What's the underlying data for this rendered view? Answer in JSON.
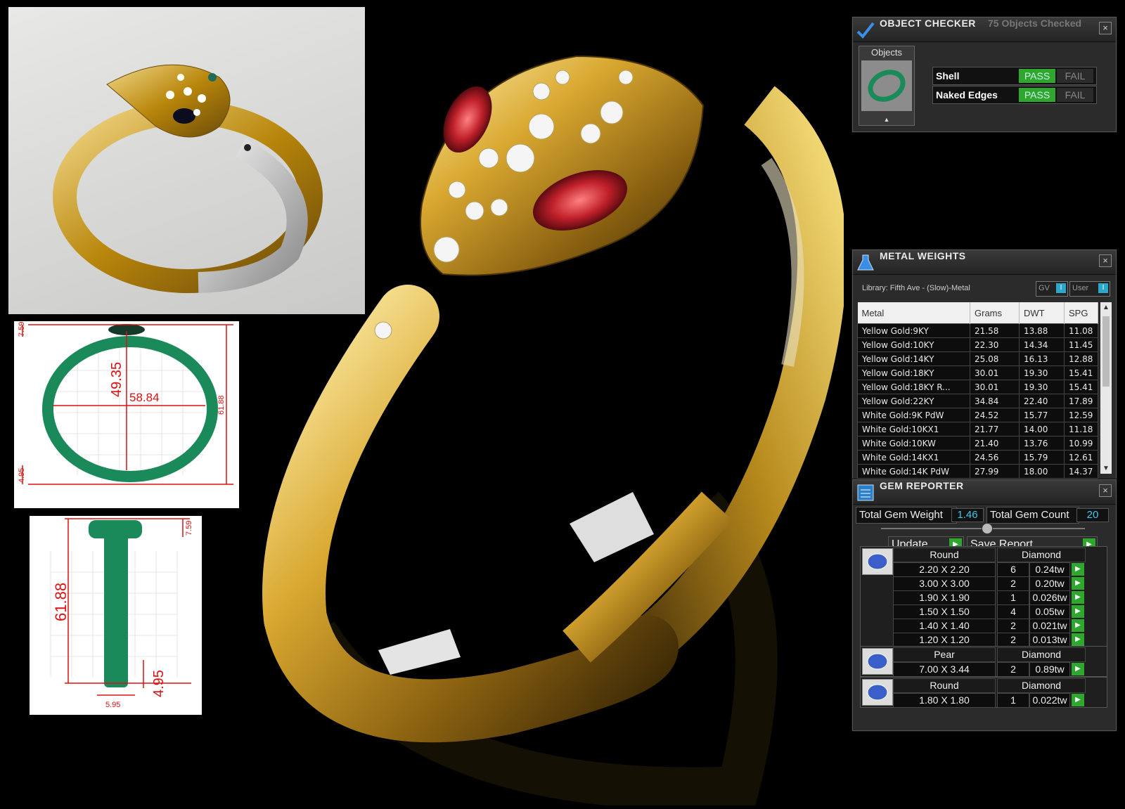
{
  "object_checker": {
    "title": "OBJECT CHECKER",
    "count_text": "75 Objects Checked",
    "objects_label": "Objects",
    "checks": [
      {
        "label": "Shell",
        "pass": "PASS",
        "fail": "FAIL"
      },
      {
        "label": "Naked Edges",
        "pass": "PASS",
        "fail": "FAIL"
      }
    ]
  },
  "metal_weights": {
    "title": "METAL WEIGHTS",
    "library": "Library: Fifth Ave - (Slow)-Metal",
    "toggle_gv": "GV",
    "toggle_user": "User",
    "columns": [
      "Metal",
      "Grams",
      "DWT",
      "SPG"
    ],
    "rows": [
      [
        "Yellow Gold:9KY",
        "21.58",
        "13.88",
        "11.08"
      ],
      [
        "Yellow Gold:10KY",
        "22.30",
        "14.34",
        "11.45"
      ],
      [
        "Yellow Gold:14KY",
        "25.08",
        "16.13",
        "12.88"
      ],
      [
        "Yellow Gold:18KY",
        "30.01",
        "19.30",
        "15.41"
      ],
      [
        "Yellow Gold:18KY R...",
        "30.01",
        "19.30",
        "15.41"
      ],
      [
        "Yellow Gold:22KY",
        "34.84",
        "22.40",
        "17.89"
      ],
      [
        "White Gold:9K PdW",
        "24.52",
        "15.77",
        "12.59"
      ],
      [
        "White Gold:10KX1",
        "21.77",
        "14.00",
        "11.18"
      ],
      [
        "White Gold:10KW",
        "21.40",
        "13.76",
        "10.99"
      ],
      [
        "White Gold:14KX1",
        "24.56",
        "15.79",
        "12.61"
      ],
      [
        "White Gold:14K PdW",
        "27.99",
        "18.00",
        "14.37"
      ]
    ]
  },
  "gem_reporter": {
    "title": "GEM REPORTER",
    "total_weight_label": "Total Gem Weight",
    "total_weight": "1.46",
    "total_count_label": "Total Gem Count",
    "total_count": "20",
    "update_label": "Update",
    "save_label": "Save Report",
    "groups": [
      {
        "shape": "Round",
        "material": "Diamond",
        "rows": [
          [
            "2.20 X 2.20",
            "6",
            "0.24tw"
          ],
          [
            "3.00 X 3.00",
            "2",
            "0.20tw"
          ],
          [
            "1.90 X 1.90",
            "1",
            "0.026tw"
          ],
          [
            "1.50 X 1.50",
            "4",
            "0.05tw"
          ],
          [
            "1.40 X 1.40",
            "2",
            "0.021tw"
          ],
          [
            "1.20 X 1.20",
            "2",
            "0.013tw"
          ]
        ]
      },
      {
        "shape": "Pear",
        "material": "Diamond",
        "rows": [
          [
            "7.00 X 3.44",
            "2",
            "0.89tw"
          ]
        ]
      },
      {
        "shape": "Round",
        "material": "Diamond",
        "rows": [
          [
            "1.80 X 1.80",
            "1",
            "0.022tw"
          ]
        ]
      }
    ]
  },
  "drawings": {
    "side_dims": [
      "7.59",
      "49.35",
      "58.84",
      "61.88",
      "4.95"
    ],
    "front_dims": [
      "7.59",
      "61.88",
      "4.95",
      "5.95"
    ]
  },
  "colors": {
    "pass_green": "#2fa72f",
    "value_cyan": "#3bc9ea",
    "dimension_red": "#dd1111",
    "ring_green": "#1a8a5a",
    "gold": "#c9a227"
  }
}
